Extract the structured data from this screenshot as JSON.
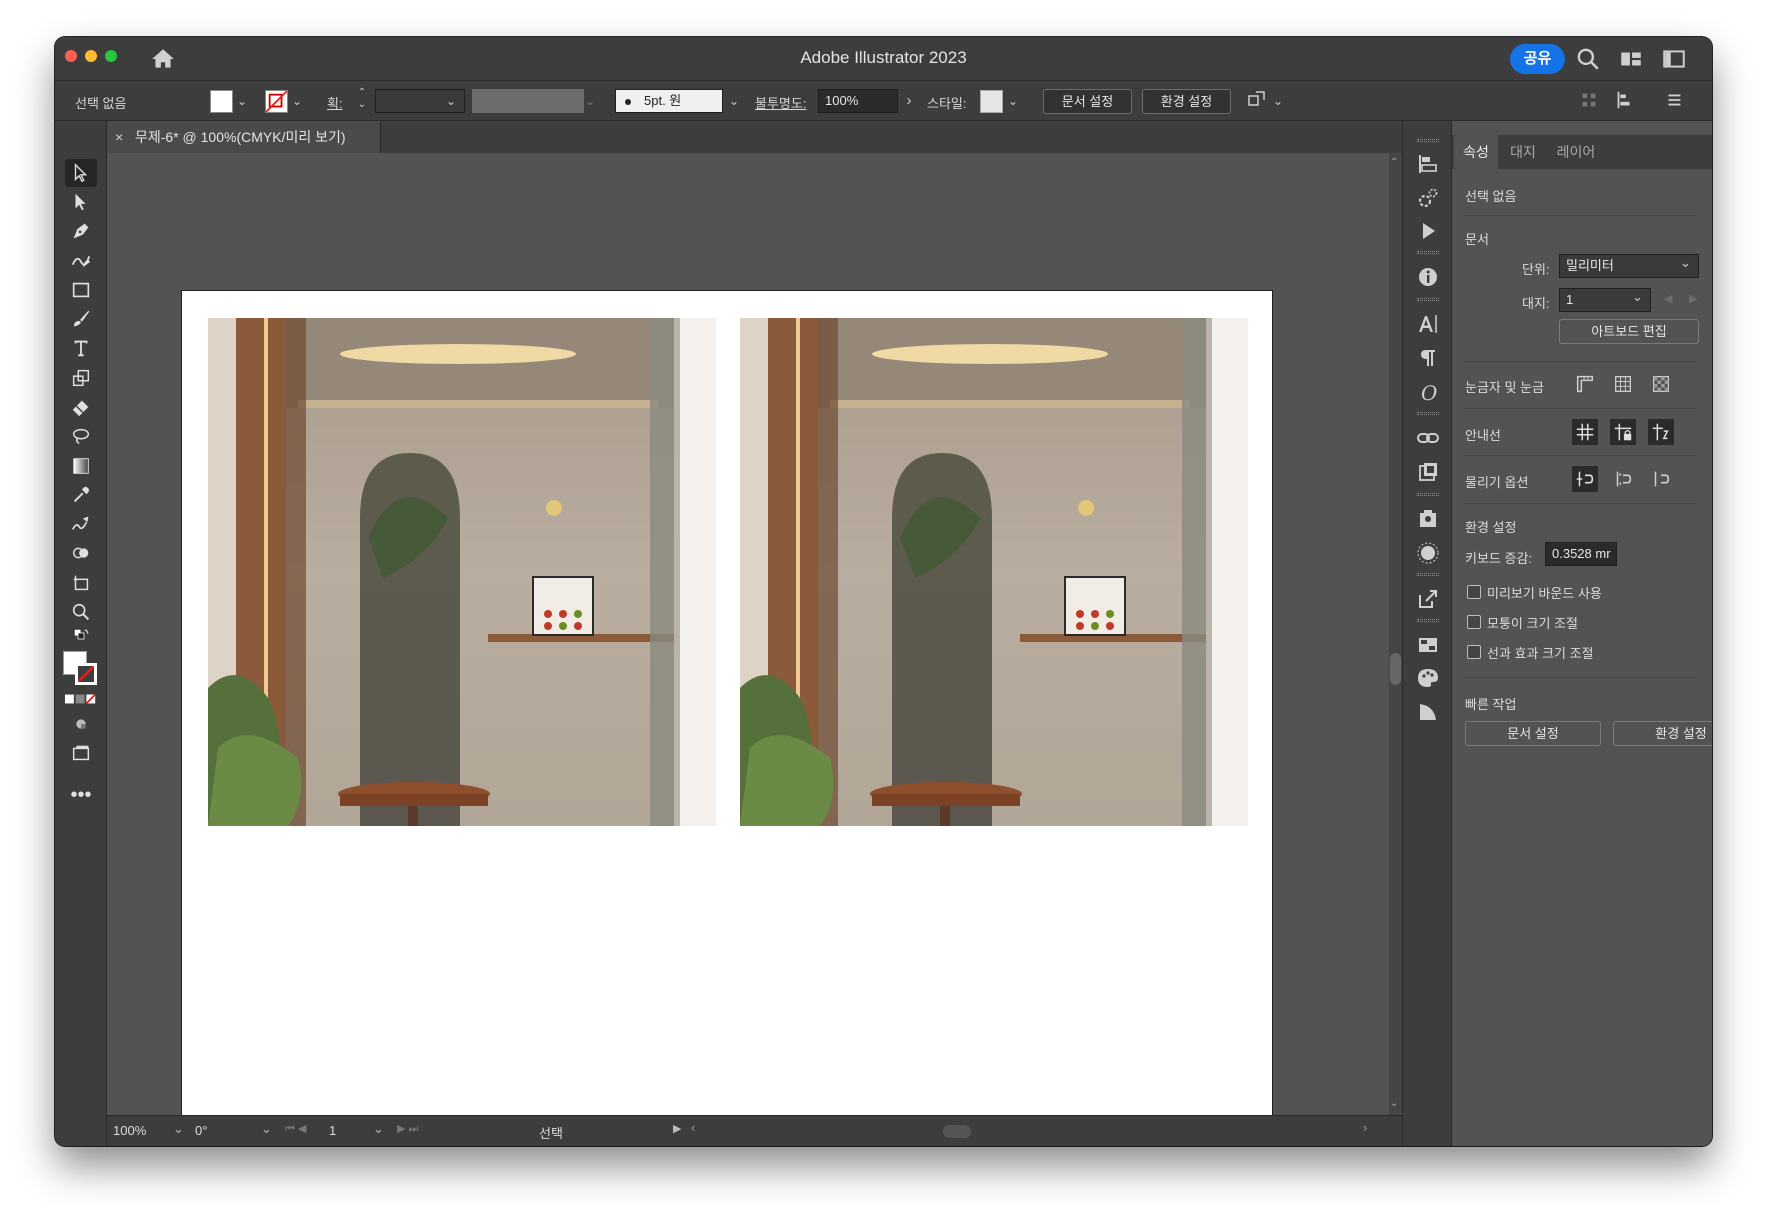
{
  "window": {
    "title": "Adobe Illustrator 2023",
    "share_label": "공유"
  },
  "control_bar": {
    "selection": "선택 없음",
    "stroke_label": "획:",
    "stroke_value": "",
    "brush": "5pt. 원",
    "opacity_label": "불투명도:",
    "opacity_value": "100%",
    "style_label": "스타일:",
    "doc_setup_button": "문서 설정",
    "preferences_button": "환경 설정"
  },
  "document_tab": {
    "close": "×",
    "label": "무제-6* @ 100%(CMYK/미리 보기)"
  },
  "status_bar": {
    "zoom": "100%",
    "rotation": "0°",
    "artboard_number": "1",
    "status_text": "선택"
  },
  "properties_panel": {
    "tabs": [
      "속성",
      "대지",
      "레이어"
    ],
    "active_tab": "속성",
    "selection": "선택 없음",
    "document_header": "문서",
    "units_label": "단위:",
    "units_value": "밀리미터",
    "artboard_label": "대지:",
    "artboard_value": "1",
    "edit_artboards_button": "아트보드 편집",
    "rulers_grids_label": "눈금자 및 눈금",
    "guides_label": "안내선",
    "snap_options_label": "물리기 옵션",
    "preferences_header": "환경 설정",
    "keyboard_increment_label": "키보드 증감:",
    "keyboard_increment_value": "0.3528 mr",
    "checkboxes": [
      "미리보기 바운드 사용",
      "모퉁이 크기 조절",
      "선과 효과 크기 조절"
    ],
    "quick_actions_header": "빠른 작업",
    "doc_setup_button": "문서 설정",
    "preferences_button": "환경 설정"
  },
  "colors": {
    "accent_blue": "#1473e6",
    "panel_dark": "#3d3d3d",
    "canvas": "#535353"
  }
}
